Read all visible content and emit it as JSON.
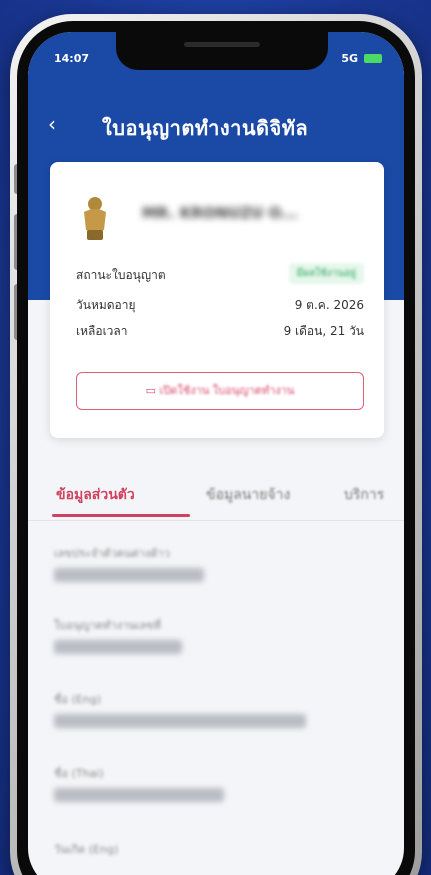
{
  "status_bar": {
    "time": "14:07",
    "network": "5G"
  },
  "nav": {
    "back": "‹",
    "title": "ใบอนุญาตทำงานดิจิทัล"
  },
  "card": {
    "holder_name": "MR. KRONUZU O...",
    "status_label": "สถานะใบอนุญาต",
    "status_value": "มีผลใช้งานอยู่",
    "expiry_label": "วันหมดอายุ",
    "expiry_value": "9 ต.ค. 2026",
    "remaining_label": "เหลือเวลา",
    "remaining_value": "9 เดือน, 21 วัน",
    "open_button_icon": "id-card-icon",
    "open_button_label": "เปิดใช้งาน ใบอนุญาตทำงาน"
  },
  "tabs": [
    {
      "label": "ข้อมูลส่วนตัว",
      "active": true
    },
    {
      "label": "ข้อมูลนายจ้าง",
      "active": false
    },
    {
      "label": "บริการ",
      "active": false
    }
  ],
  "fields": [
    {
      "label": "เลขประจำตัวคนต่างด้าว"
    },
    {
      "label": "ใบอนุญาตทำงานเลขที่"
    },
    {
      "label": "ชื่อ (Eng)"
    },
    {
      "label": "ชื่อ (Thai)"
    },
    {
      "label": "วันเกิด (Eng)"
    }
  ],
  "colors": {
    "header": "#1a4aa6",
    "accent": "#d0425f",
    "status_green": "#2aa45a",
    "background": "#1e3fa0"
  }
}
